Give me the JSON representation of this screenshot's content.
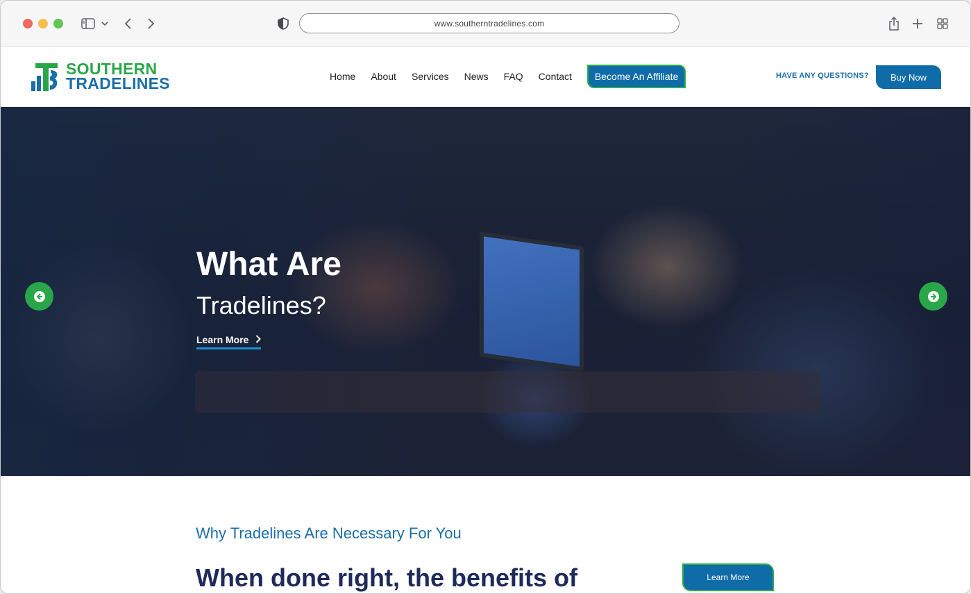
{
  "browser": {
    "url": "www.southerntradelines.com"
  },
  "site": {
    "logo": {
      "line1": "SOUTHERN",
      "line2": "TRADELINES"
    },
    "nav": [
      {
        "label": "Home"
      },
      {
        "label": "About"
      },
      {
        "label": "Services"
      },
      {
        "label": "News"
      },
      {
        "label": "FAQ"
      },
      {
        "label": "Contact"
      }
    ],
    "affiliate_label": "Become An Affiliate",
    "questions_label": "HAVE ANY QUESTIONS?",
    "buy_label": "Buy Now"
  },
  "hero": {
    "title": "What Are",
    "subtitle": "Tradelines?",
    "link_label": "Learn More"
  },
  "section": {
    "eyebrow": "Why Tradelines Are Necessary For You",
    "heading": "When done right, the benefits of",
    "button_label": "Learn More"
  },
  "colors": {
    "brand_green": "#2aa64a",
    "brand_blue": "#1b6ea8",
    "button_blue": "#0f6ca8",
    "heading_navy": "#1e2a5a"
  }
}
